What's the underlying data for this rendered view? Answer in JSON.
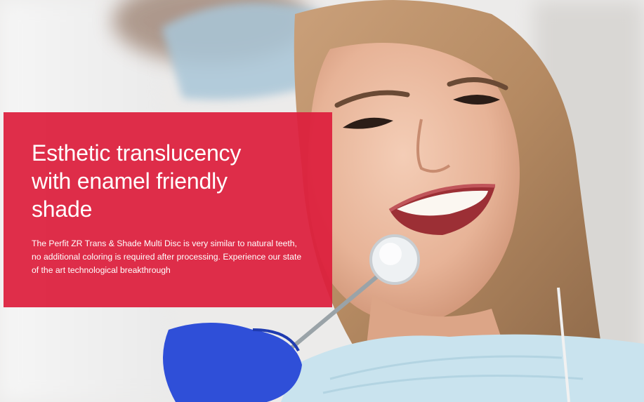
{
  "hero": {
    "headline": "Esthetic translucency with enamel friendly shade",
    "body": "The Perfit ZR Trans & Shade Multi Disc is very similar to natural teeth, no additional coloring is required after processing. Experience our state of the art technological breakthrough"
  },
  "colors": {
    "panel": "#dd1e3c",
    "text": "#ffffff",
    "glove": "#2f4fd8",
    "bib": "#c9e3ee",
    "hair": "#b58a62"
  },
  "image": {
    "subject": "smiling-woman-dental-exam-photo",
    "icons": [
      "dental-mirror-icon",
      "gloved-hand-icon"
    ]
  }
}
